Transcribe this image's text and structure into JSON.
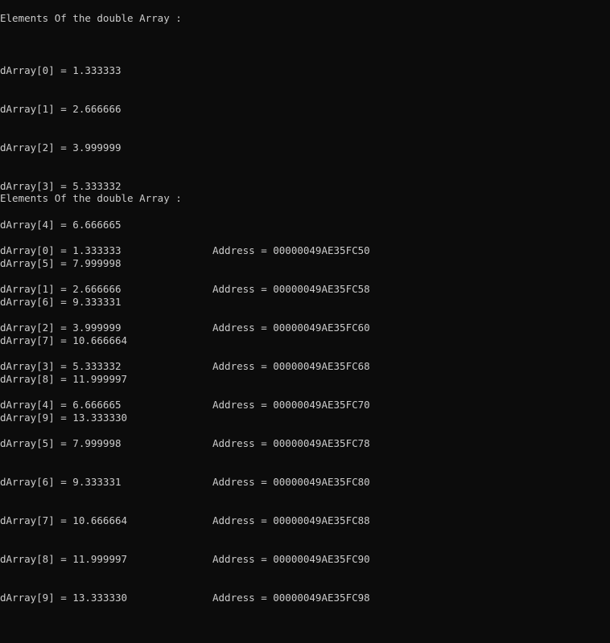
{
  "console": {
    "header_1": "Elements Of the double Array :",
    "block_1": [
      "dArray[0] = 1.333333",
      "dArray[1] = 2.666666",
      "dArray[2] = 3.999999",
      "dArray[3] = 5.333332",
      "dArray[4] = 6.666665",
      "dArray[5] = 7.999998",
      "dArray[6] = 9.333331",
      "dArray[7] = 10.666664",
      "dArray[8] = 11.999997",
      "dArray[9] = 13.333330"
    ],
    "header_2": "Elements Of the double Array :",
    "block_2": [
      {
        "value": "dArray[0] = 1.333333",
        "address": "Address = 00000049AE35FC50"
      },
      {
        "value": "dArray[1] = 2.666666",
        "address": "Address = 00000049AE35FC58"
      },
      {
        "value": "dArray[2] = 3.999999",
        "address": "Address = 00000049AE35FC60"
      },
      {
        "value": "dArray[3] = 5.333332",
        "address": "Address = 00000049AE35FC68"
      },
      {
        "value": "dArray[4] = 6.666665",
        "address": "Address = 00000049AE35FC70"
      },
      {
        "value": "dArray[5] = 7.999998",
        "address": "Address = 00000049AE35FC78"
      },
      {
        "value": "dArray[6] = 9.333331",
        "address": "Address = 00000049AE35FC80"
      },
      {
        "value": "dArray[7] = 10.666664",
        "address": "Address = 00000049AE35FC88"
      },
      {
        "value": "dArray[8] = 11.999997",
        "address": "Address = 00000049AE35FC90"
      },
      {
        "value": "dArray[9] = 13.333330",
        "address": "Address = 00000049AE35FC98"
      }
    ]
  },
  "colors": {
    "background": "#0c0c0c",
    "text": "#cccccc"
  }
}
